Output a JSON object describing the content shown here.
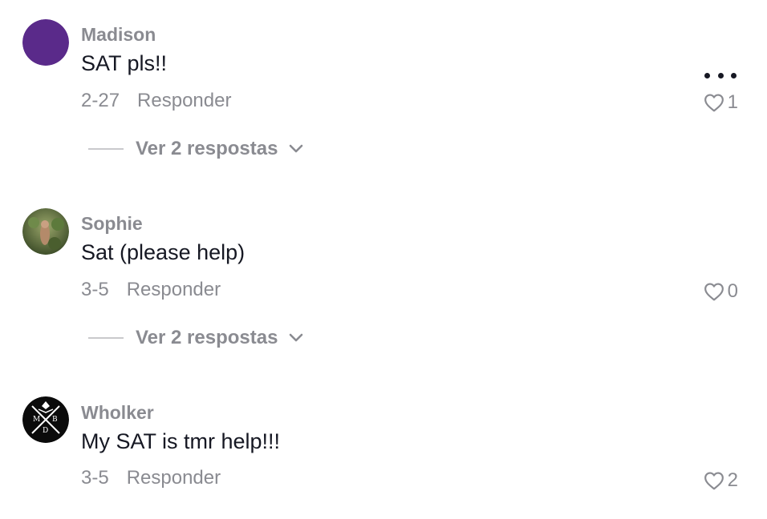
{
  "comments": [
    {
      "username": "Madison",
      "text": "SAT pls!!",
      "date": "2-27",
      "reply_label": "Responder",
      "likes": "1",
      "view_replies": "Ver 2 respostas",
      "avatar_color": "#5a2a8a"
    },
    {
      "username": "Sophie",
      "text": "Sat (please help)",
      "date": "3-5",
      "reply_label": "Responder",
      "likes": "0",
      "view_replies": "Ver 2 respostas"
    },
    {
      "username": "Wholker",
      "text": "My SAT is tmr help!!!",
      "date": "3-5",
      "reply_label": "Responder",
      "likes": "2"
    }
  ],
  "icons": {
    "more": "more-options-icon",
    "like": "heart-outline-icon",
    "expand": "chevron-down-icon"
  }
}
